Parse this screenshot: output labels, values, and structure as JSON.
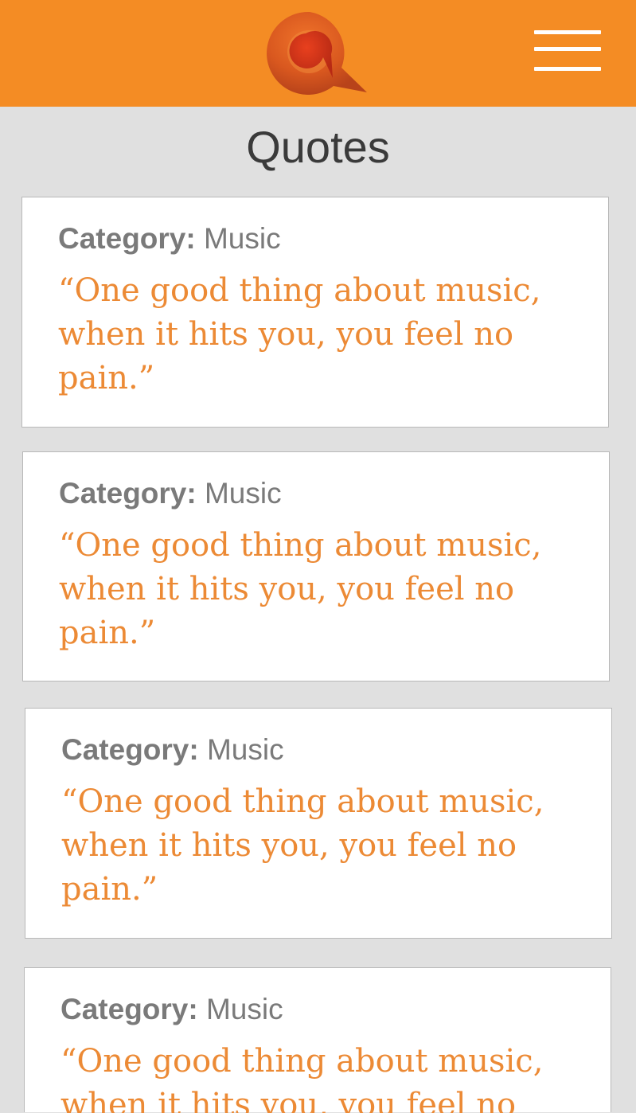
{
  "header": {
    "logo_icon": "q-speech-bubble-logo-icon",
    "menu_icon": "hamburger-menu-icon",
    "brand_color": "#f48c24"
  },
  "page": {
    "title": "Quotes"
  },
  "quotes": [
    {
      "category_label": "Category:",
      "category_value": "Music",
      "text": "“One good thing about music, when it hits you, you feel no pain.”"
    },
    {
      "category_label": "Category:",
      "category_value": "Music",
      "text": "“One good thing about music, when it hits you, you feel no pain.”"
    },
    {
      "category_label": "Category:",
      "category_value": "Music",
      "text": "“One good thing about music, when it hits you, you feel no pain.”"
    },
    {
      "category_label": "Category:",
      "category_value": "Music",
      "text": "“One good thing about music, when it hits you, you feel no pain.”"
    }
  ],
  "colors": {
    "background": "#e0e0e0",
    "quote_text": "#ec8a35",
    "category_text": "#7a7a7a",
    "title_text": "#3a3a3a"
  }
}
